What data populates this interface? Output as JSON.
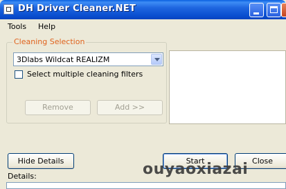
{
  "window": {
    "title": "DH Driver Cleaner.NET",
    "controls": [
      "minimize",
      "maximize",
      "close"
    ]
  },
  "menu": {
    "items": [
      "Tools",
      "Help"
    ]
  },
  "cleaning_selection": {
    "legend": "Cleaning Selection",
    "selected_driver": "3Dlabs Wildcat REALIZM",
    "multiple_filters_label": "Select multiple cleaning filters",
    "multiple_filters_checked": false,
    "remove_label": "Remove",
    "add_label": "Add >>"
  },
  "filter_list": {
    "items": []
  },
  "actions": {
    "hide_details_label": "Hide Details",
    "start_label": "Start",
    "close_label": "Close"
  },
  "details": {
    "label": "Details:"
  },
  "watermark": {
    "text": "ouyaoxiazai"
  },
  "colors": {
    "titlebar": "#0a4fd0",
    "legend": "#e0631e",
    "background": "#ece9d8"
  }
}
